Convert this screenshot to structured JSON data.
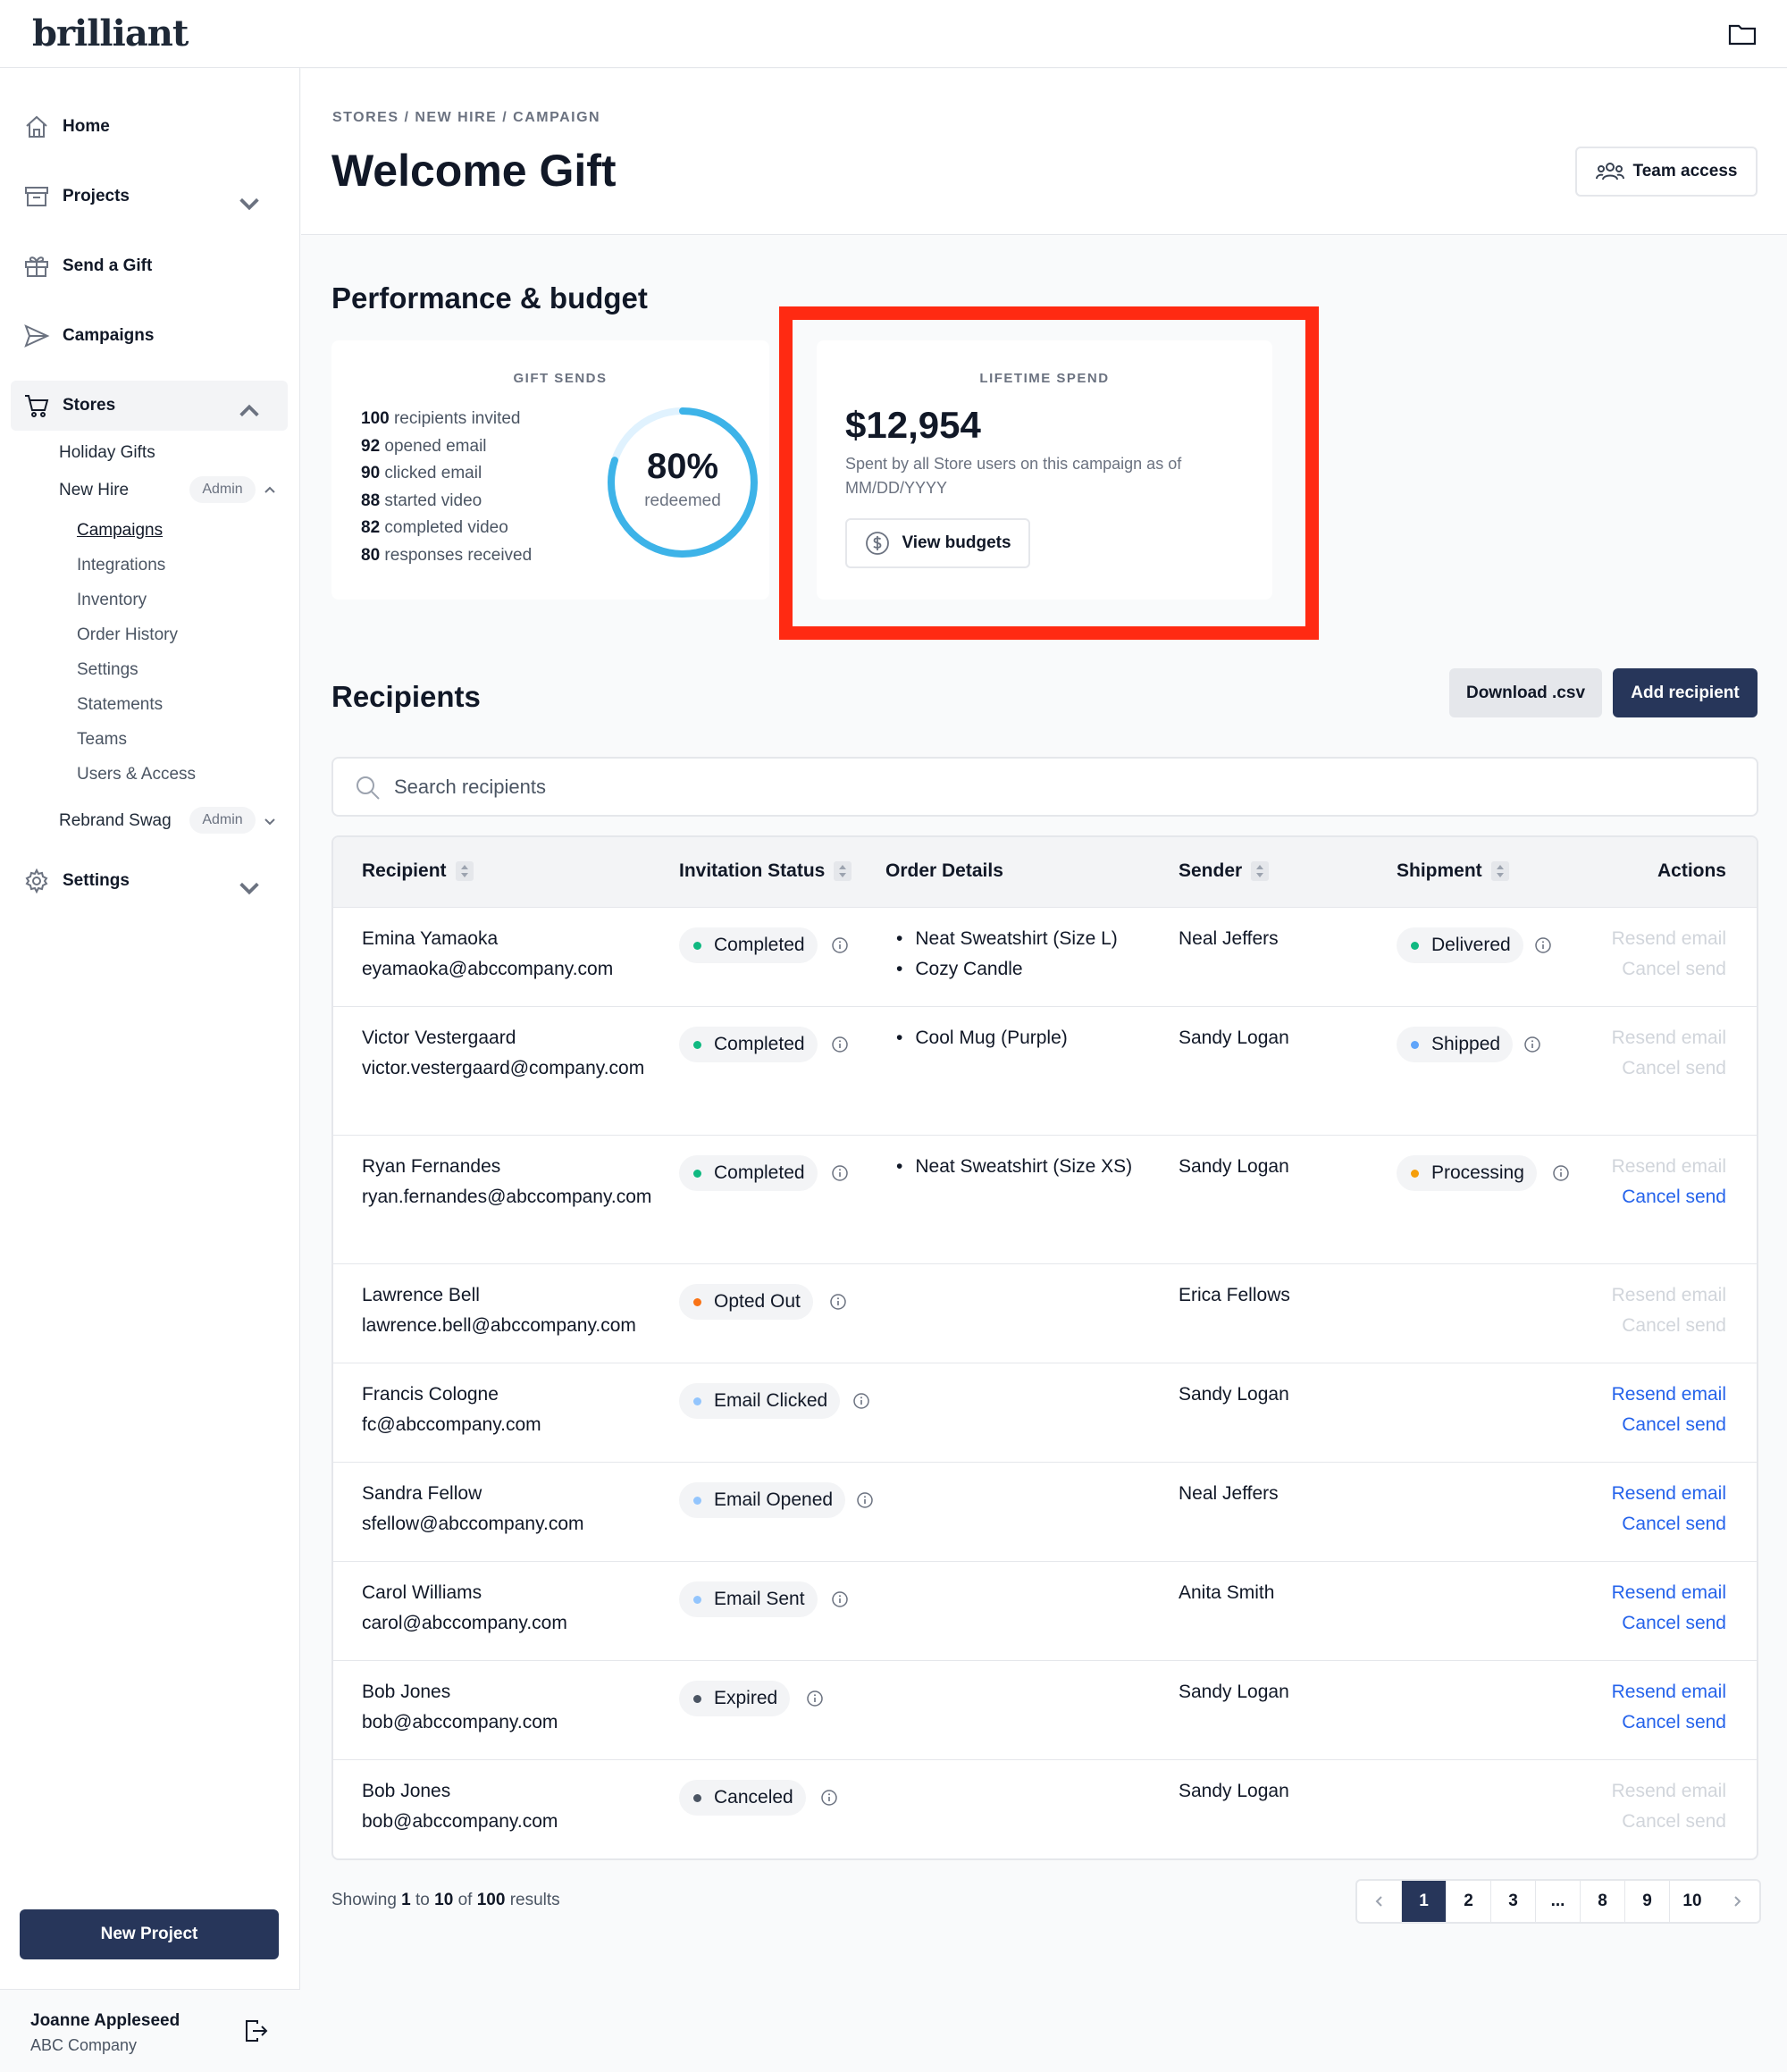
{
  "app": {
    "logo": "brilliant"
  },
  "sidebar": {
    "home": "Home",
    "projects": "Projects",
    "send_gift": "Send a Gift",
    "campaigns": "Campaigns",
    "stores": "Stores",
    "holiday_gifts": "Holiday Gifts",
    "new_hire": "New Hire",
    "admin_badge": "Admin",
    "new_hire_items": [
      "Campaigns",
      "Integrations",
      "Inventory",
      "Order History",
      "Settings",
      "Statements",
      "Teams",
      "Users & Access"
    ],
    "rebrand_swag": "Rebrand Swag",
    "settings": "Settings",
    "new_project": "New Project",
    "user_name": "Joanne Appleseed",
    "user_company": "ABC Company"
  },
  "header": {
    "breadcrumb": "STORES / NEW HIRE / CAMPAIGN",
    "title": "Welcome Gift",
    "team_access": "Team access"
  },
  "performance": {
    "title": "Performance & budget",
    "gift_sends_label": "GIFT SENDS",
    "stats": [
      {
        "num": "100",
        "text": "recipients invited"
      },
      {
        "num": "92",
        "text": "opened email"
      },
      {
        "num": "90",
        "text": "clicked email"
      },
      {
        "num": "88",
        "text": "started video"
      },
      {
        "num": "82",
        "text": "completed video"
      },
      {
        "num": "80",
        "text": "responses received"
      }
    ],
    "redeemed_pct": "80%",
    "redeemed_fraction": 0.8,
    "redeemed_label": "redeemed",
    "lifetime_label": "LIFETIME SPEND",
    "lifetime_amount": "$12,954",
    "lifetime_desc": "Spent by all Store users on this campaign as of MM/DD/YYYY",
    "view_budgets": "View budgets"
  },
  "recipients": {
    "title": "Recipients",
    "download": "Download .csv",
    "add": "Add recipient",
    "search_placeholder": "Search recipients",
    "columns": [
      "Recipient",
      "Invitation Status",
      "Order Details",
      "Sender",
      "Shipment",
      "Actions"
    ],
    "rows": [
      {
        "name": "Emina Yamaoka",
        "email": "eyamaoka@abccompany.com",
        "status": "Completed",
        "items": [
          "Neat Sweatshirt (Size L)",
          "Cozy Candle"
        ],
        "sender": "Neal Jeffers",
        "shipment": "Delivered",
        "resend": "Resend email",
        "cancel": "Cancel send"
      },
      {
        "name": "Victor Vestergaard",
        "email": "victor.vestergaard@company.com",
        "status": "Completed",
        "items": [
          "Cool Mug (Purple)"
        ],
        "sender": "Sandy Logan",
        "shipment": "Shipped",
        "resend": "Resend email",
        "cancel": "Cancel send"
      },
      {
        "name": "Ryan Fernandes",
        "email": "ryan.fernandes@abccompany.com",
        "status": "Completed",
        "items": [
          "Neat Sweatshirt (Size XS)"
        ],
        "sender": "Sandy Logan",
        "shipment": "Processing",
        "resend": "Resend email",
        "cancel": "Cancel send"
      },
      {
        "name": "Lawrence Bell",
        "email": "lawrence.bell@abccompany.com",
        "status": "Opted Out",
        "items": [],
        "sender": "Erica Fellows",
        "shipment": "",
        "resend": "Resend email",
        "cancel": "Cancel send"
      },
      {
        "name": "Francis Cologne",
        "email": "fc@abccompany.com",
        "status": "Email Clicked",
        "items": [],
        "sender": "Sandy Logan",
        "shipment": "",
        "resend": "Resend email",
        "cancel": "Cancel send"
      },
      {
        "name": "Sandra Fellow",
        "email": "sfellow@abccompany.com",
        "status": "Email Opened",
        "items": [],
        "sender": "Neal Jeffers",
        "shipment": "",
        "resend": "Resend email",
        "cancel": "Cancel send"
      },
      {
        "name": "Carol Williams",
        "email": "carol@abccompany.com",
        "status": "Email Sent",
        "items": [],
        "sender": "Anita Smith",
        "shipment": "",
        "resend": "Resend email",
        "cancel": "Cancel send"
      },
      {
        "name": "Bob Jones",
        "email": "bob@abccompany.com",
        "status": "Expired",
        "items": [],
        "sender": "Sandy Logan",
        "shipment": "",
        "resend": "Resend email",
        "cancel": "Cancel send"
      },
      {
        "name": "Bob Jones",
        "email": "bob@abccompany.com",
        "status": "Canceled",
        "items": [],
        "sender": "Sandy Logan",
        "shipment": "",
        "resend": "Resend email",
        "cancel": "Cancel send"
      }
    ]
  },
  "pagination": {
    "showing_prefix": "Showing",
    "from": "1",
    "to_word": "to",
    "to": "10",
    "of_word": "of",
    "total": "100",
    "results_word": "results",
    "pages": [
      "1",
      "2",
      "3",
      "...",
      "8",
      "9",
      "10"
    ]
  },
  "colors": {
    "accent": "#27365a",
    "link": "#2563eb",
    "completed": "#10b981",
    "opted_out": "#f97316",
    "email": "#93c5fd",
    "expired": "#4b5563",
    "processing": "#f59e0b",
    "shipped": "#60a5fa",
    "donut": "#3db3e8",
    "highlight": "#ff2a12"
  }
}
